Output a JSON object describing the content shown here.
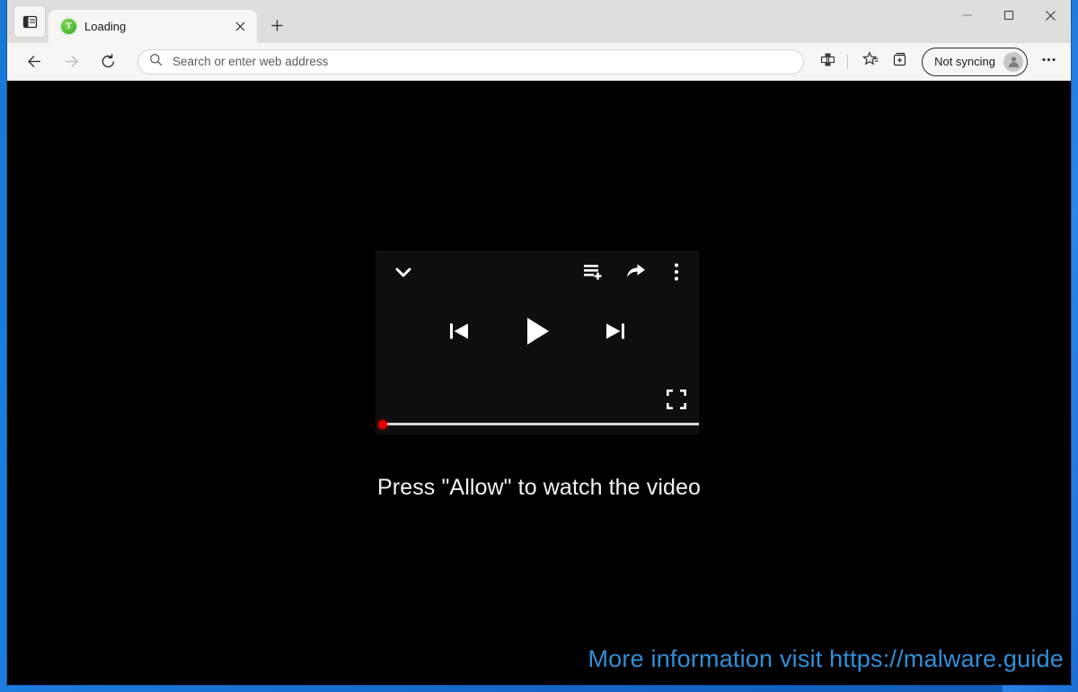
{
  "window": {
    "controls": [
      {
        "name": "minimize-button",
        "glyph": "minimize-icon"
      },
      {
        "name": "maximize-button",
        "glyph": "maximize-icon"
      },
      {
        "name": "close-button",
        "glyph": "close-icon"
      }
    ]
  },
  "tabstrip": {
    "tab_actions_tooltip": "Tab actions menu",
    "new_tab_tooltip": "New tab",
    "tabs": [
      {
        "title": "Loading",
        "favicon_letter": "T",
        "favicon_color": "#5ec43f",
        "active": true,
        "close_tooltip": "Close tab"
      }
    ]
  },
  "toolbar": {
    "back_tooltip": "Back",
    "forward_tooltip": "Forward",
    "refresh_tooltip": "Refresh",
    "address": {
      "value": "",
      "placeholder": "Search or enter web address"
    },
    "icons": [
      {
        "name": "split-screen-icon",
        "tooltip": "Split screen"
      },
      {
        "name": "favorites-icon",
        "tooltip": "Favorites"
      },
      {
        "name": "collections-icon",
        "tooltip": "Collections"
      }
    ],
    "profile": {
      "label": "Not syncing",
      "avatar": "person-icon"
    },
    "settings_tooltip": "Settings and more"
  },
  "page": {
    "background_color": "#000000",
    "player": {
      "background_color": "#0e0e0e",
      "controls": {
        "collapse": "chevron-down-icon",
        "queue": "add-to-queue-icon",
        "share": "share-icon",
        "more": "more-vertical-icon",
        "previous": "skip-previous-icon",
        "play": "play-icon",
        "next": "skip-next-icon",
        "fullscreen": "fullscreen-icon"
      },
      "progress": {
        "percent": 0,
        "thumb_color": "#e80000",
        "track_color": "#d8d8d8"
      }
    },
    "message": "Press \"Allow\" to watch the video",
    "watermark": {
      "text": "More information visit https://malware.guide",
      "color": "#2f8fd8"
    }
  }
}
